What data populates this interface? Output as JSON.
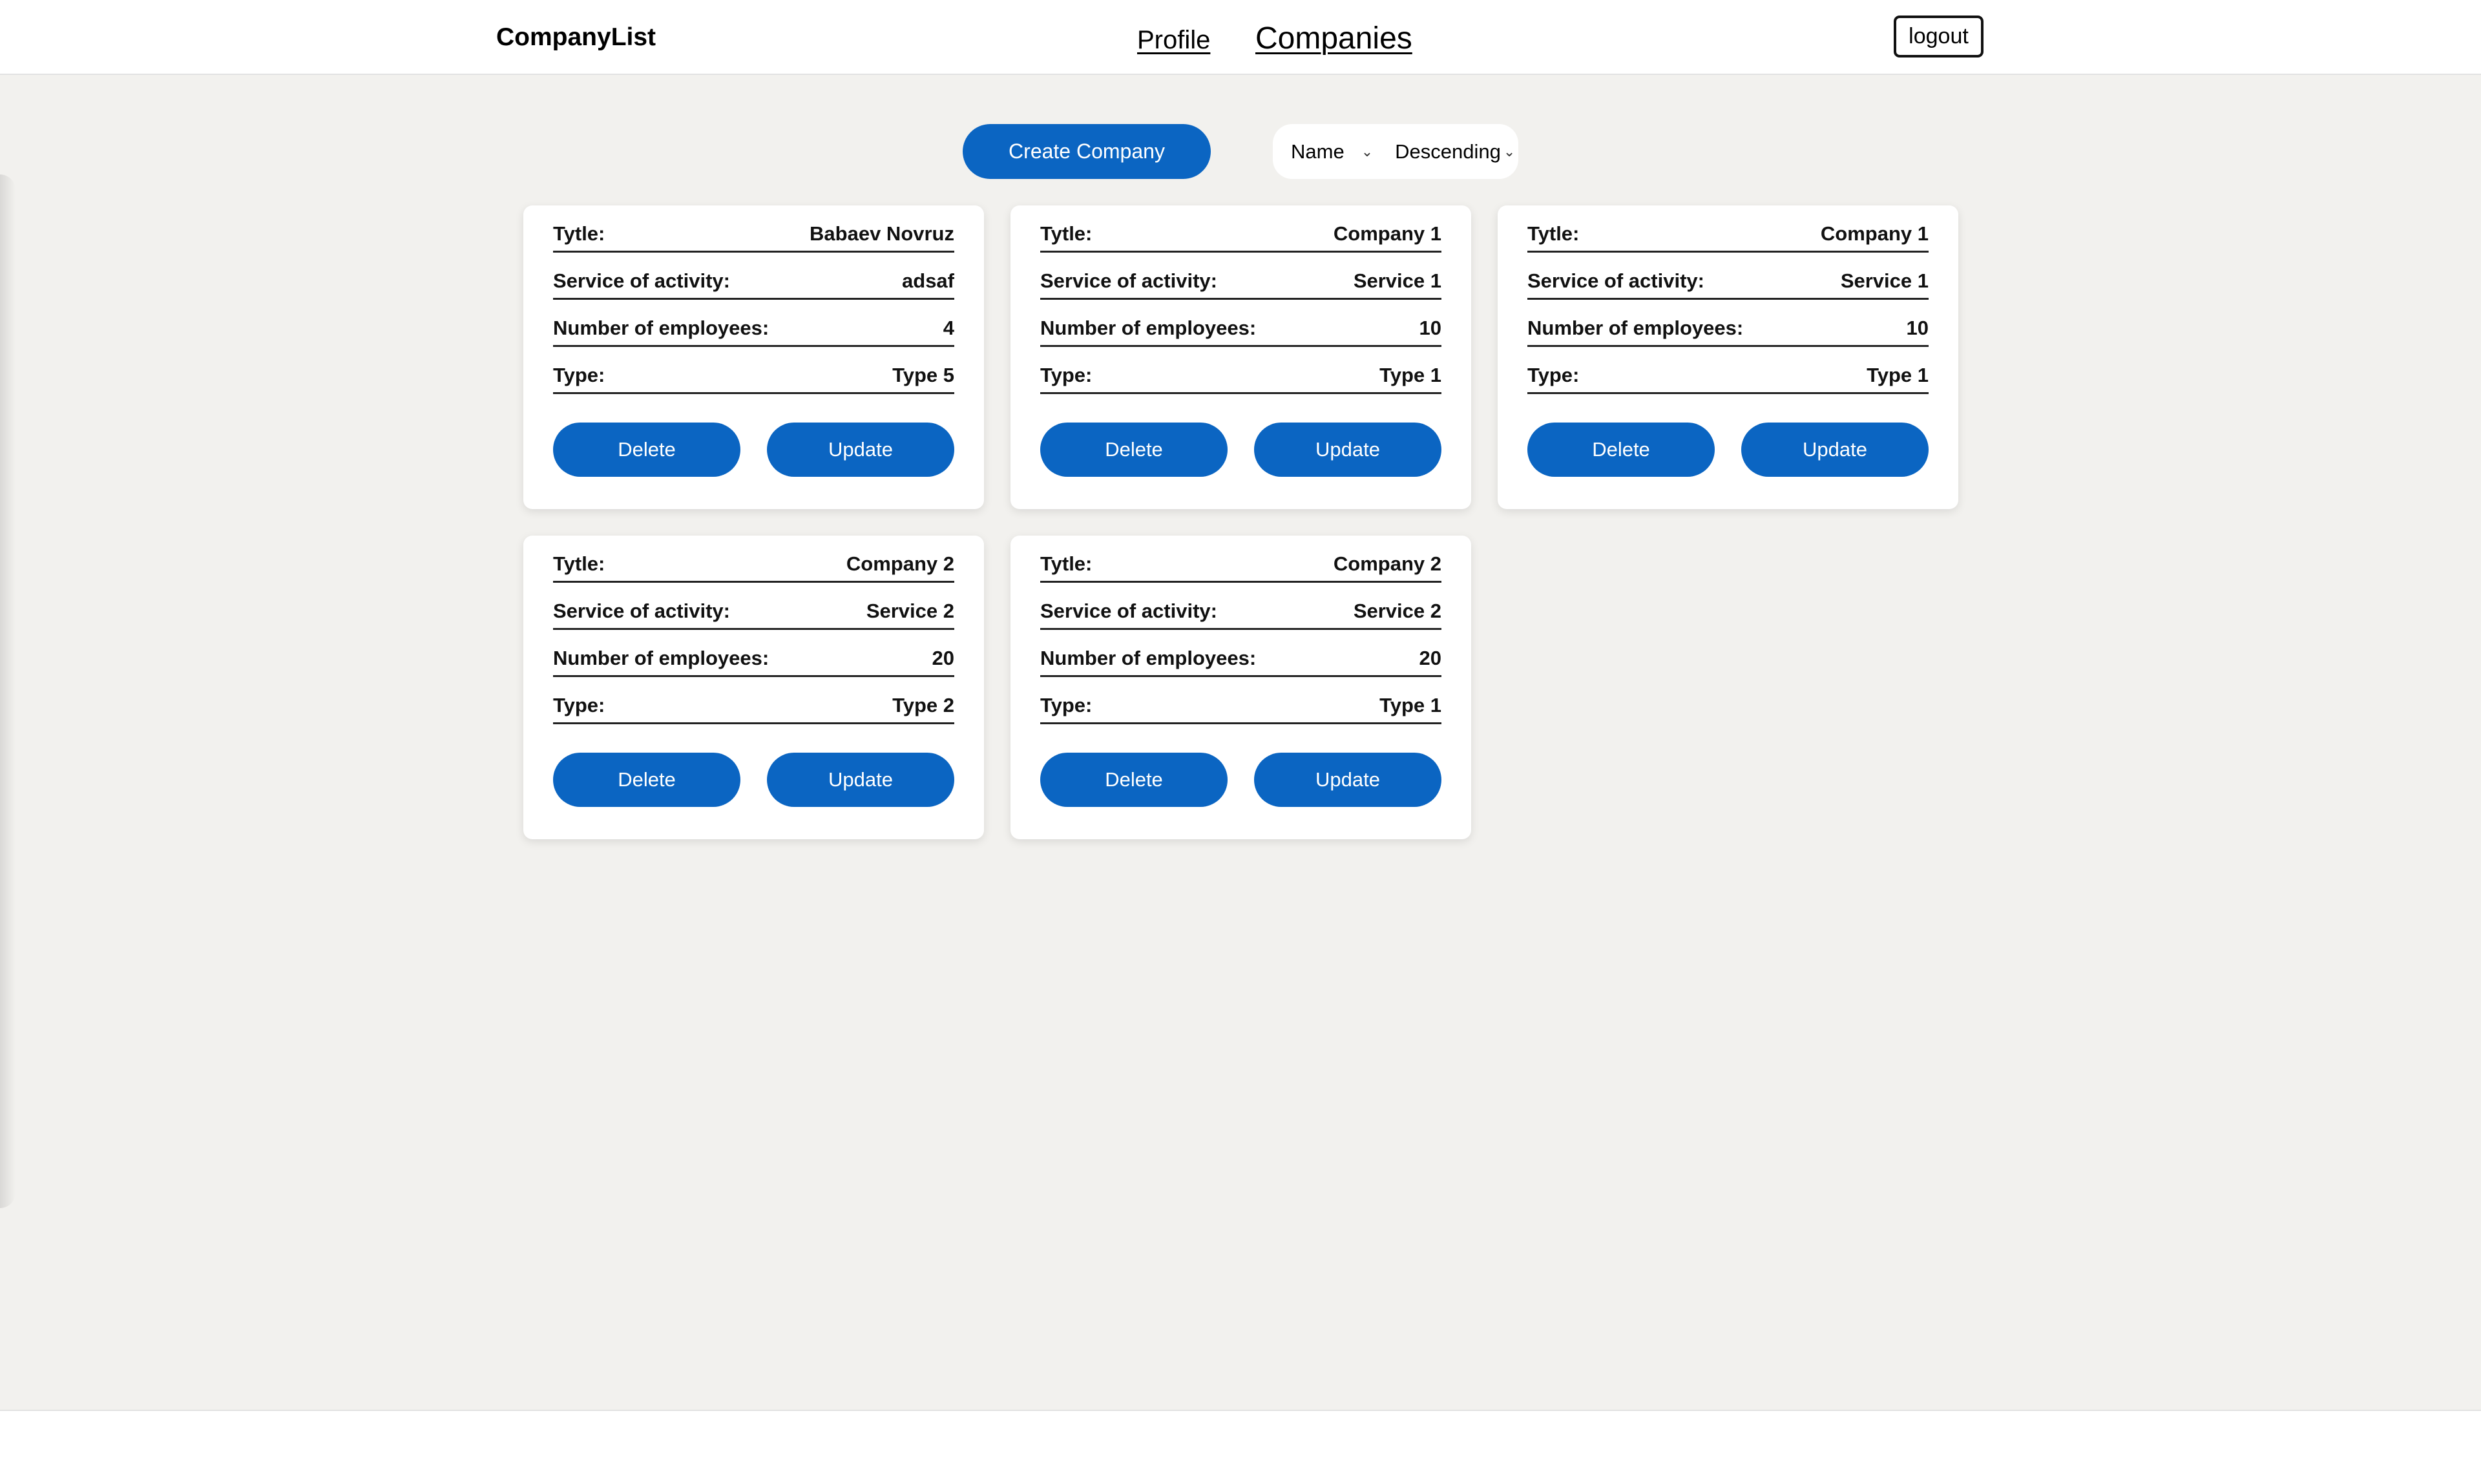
{
  "header": {
    "brand": "CompanyList",
    "nav": {
      "profile": "Profile",
      "companies": "Companies"
    },
    "logout": "logout"
  },
  "toolbar": {
    "create_label": "Create Company",
    "sort_field": "Name",
    "sort_order": "Descending"
  },
  "labels": {
    "title": "Tytle:",
    "service": "Service of activity:",
    "employees": "Number of employees:",
    "type": "Type:",
    "delete": "Delete",
    "update": "Update"
  },
  "companies": [
    {
      "title": "Babaev Novruz",
      "service": "adsaf",
      "employees": "4",
      "type": "Type 5"
    },
    {
      "title": "Company 1",
      "service": "Service 1",
      "employees": "10",
      "type": "Type 1"
    },
    {
      "title": "Company 1",
      "service": "Service 1",
      "employees": "10",
      "type": "Type 1"
    },
    {
      "title": "Company 2",
      "service": "Service 2",
      "employees": "20",
      "type": "Type 2"
    },
    {
      "title": "Company 2",
      "service": "Service 2",
      "employees": "20",
      "type": "Type 1"
    }
  ],
  "icons": {
    "chevron": "chevron-down-icon"
  },
  "colors": {
    "accent": "#0b65c2",
    "background": "#f2f1ee"
  }
}
